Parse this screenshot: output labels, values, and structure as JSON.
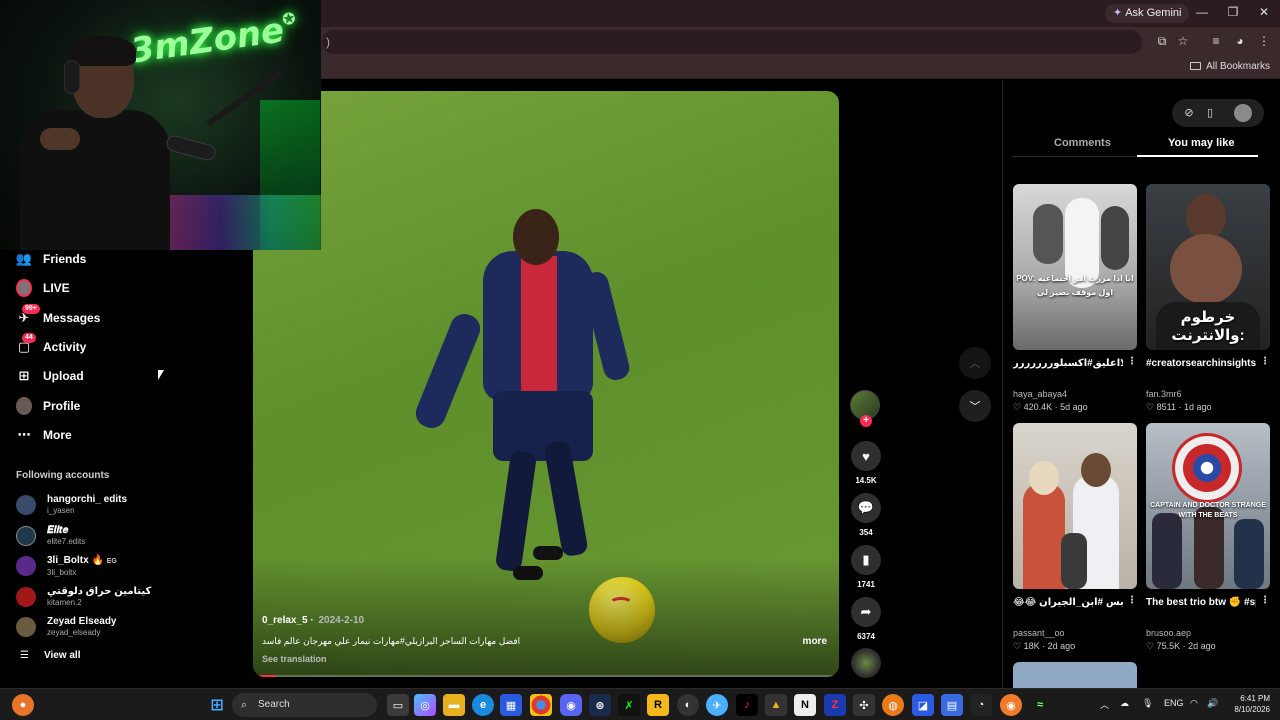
{
  "browser": {
    "ask_gemini": "Ask Gemini",
    "all_bookmarks": "All Bookmarks",
    "address_fragment": ")"
  },
  "webcam": {
    "logo_text": "3mZone"
  },
  "sidebar": {
    "items": [
      {
        "label": "Friends",
        "icon": "friends-icon"
      },
      {
        "label": "LIVE",
        "icon": "live-icon"
      },
      {
        "label": "Messages",
        "icon": "messages-icon",
        "badge": "99+"
      },
      {
        "label": "Activity",
        "icon": "activity-icon",
        "badge": "44"
      },
      {
        "label": "Upload",
        "icon": "upload-icon"
      },
      {
        "label": "Profile",
        "icon": "profile-icon"
      },
      {
        "label": "More",
        "icon": "more-icon"
      }
    ],
    "following_title": "Following accounts",
    "accounts": [
      {
        "name": "hangorchi_ edits",
        "handle": "i_yasen",
        "color": "#3a4a6a"
      },
      {
        "name": "𝑬𝒍𝒊𝒕𝒆",
        "handle": "elite7.edits",
        "color": "#1e3a4a"
      },
      {
        "name": "3li_Boltx",
        "tag": "EG",
        "handle": "3li_boltx",
        "color": "#5a2a8a"
      },
      {
        "name": "كيتامين حراق دلوقتي",
        "handle": "kitamen.2",
        "color": "#a01818"
      },
      {
        "name": "Zeyad Elseady",
        "handle": "zeyad_elseady",
        "color": "#6a5a40"
      }
    ],
    "view_all": "View all"
  },
  "video": {
    "author": "0_relax_5",
    "date": "2024-2-10",
    "description": "افضل مهارات الساحر البرازيلي#مهارات نيمار علي مهرجان عالم فاسد",
    "more": "more",
    "see_translation": "See translation",
    "progress": 0.04
  },
  "actions": {
    "likes": "14.5K",
    "comments": "354",
    "saves": "1741",
    "shares": "6374"
  },
  "right_panel": {
    "tab_comments": "Comments",
    "tab_you_may_like": "You may like",
    "active_tab": "You may like",
    "cards": [
      {
        "caption": "لااعليق#اكسبلوررررررر #parati #انتشار_سريع...",
        "user": "haya_abaya4",
        "likes": "420.4K",
        "age": "5d ago",
        "overlay": "POV: انا اذا مررت امر اجتماعيه اول موقف بصير لي"
      },
      {
        "caption": "#creatorsearchinsights خرطوم_البابا_دوت# #viral...",
        "user": "fan.3mr6",
        "likes": "8511",
        "age": "1d ago",
        "overlay": "خرطوم والانترنت:"
      },
      {
        "caption": "😂😂 ربنا يحنلك يارب 😂😂 #بس #ابن_الجيران...",
        "user": "passant__oo",
        "likes": "18K",
        "age": "2d ago",
        "overlay": ""
      },
      {
        "caption": "The best trio btw ✊ #spiderman...",
        "user": "brusoo.aep",
        "likes": "75.5K",
        "age": "2d ago",
        "overlay": "CAPTAIN AND DOCTOR STRANGE WITH THE BEATS"
      }
    ]
  },
  "taskbar": {
    "search_placeholder": "Search",
    "language": "ENG",
    "time": "6:41 PM",
    "date": "8/10/2026"
  }
}
